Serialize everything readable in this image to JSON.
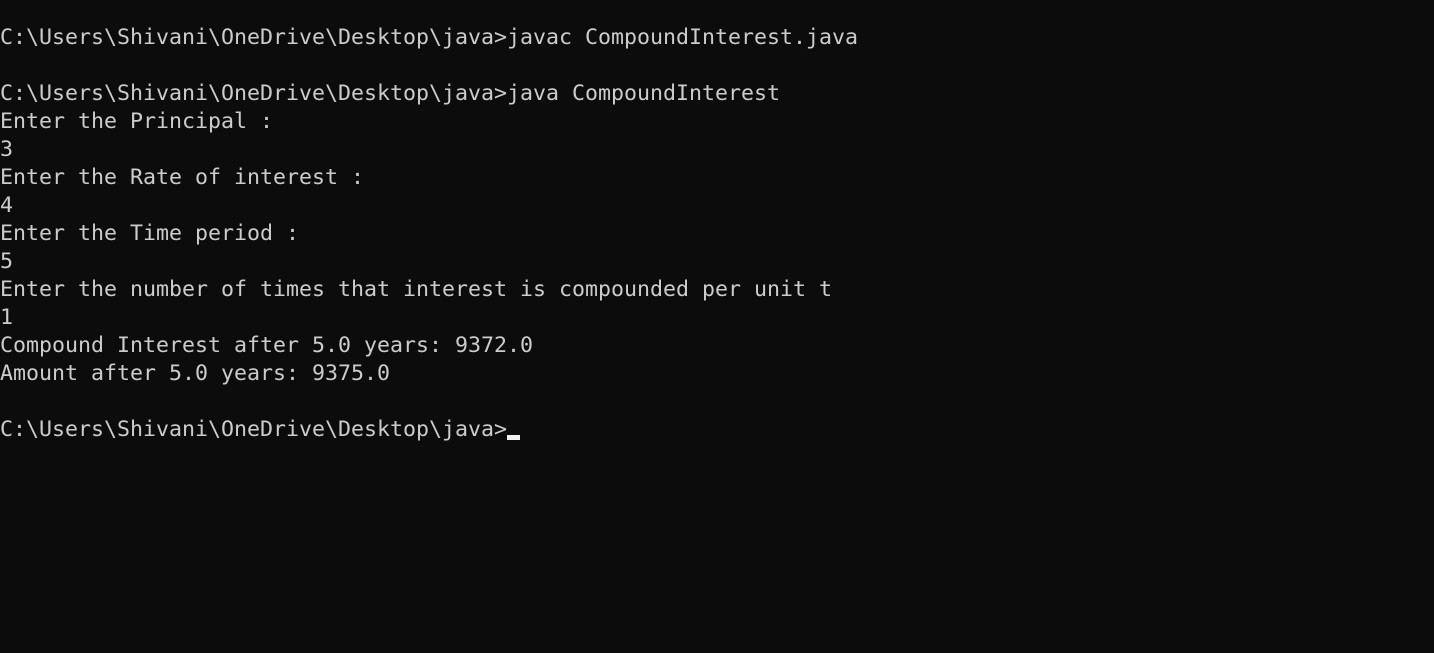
{
  "terminal": {
    "lines": [
      "C:\\Users\\Shivani\\OneDrive\\Desktop\\java>javac CompoundInterest.java",
      "",
      "C:\\Users\\Shivani\\OneDrive\\Desktop\\java>java CompoundInterest",
      "Enter the Principal :",
      "3",
      "Enter the Rate of interest :",
      "4",
      "Enter the Time period :",
      "5",
      "Enter the number of times that interest is compounded per unit t",
      "1",
      "Compound Interest after 5.0 years: 9372.0",
      "Amount after 5.0 years: 9375.0",
      ""
    ],
    "prompt": "C:\\Users\\Shivani\\OneDrive\\Desktop\\java>",
    "colors": {
      "background": "#0c0c0c",
      "foreground": "#cccccc"
    }
  }
}
